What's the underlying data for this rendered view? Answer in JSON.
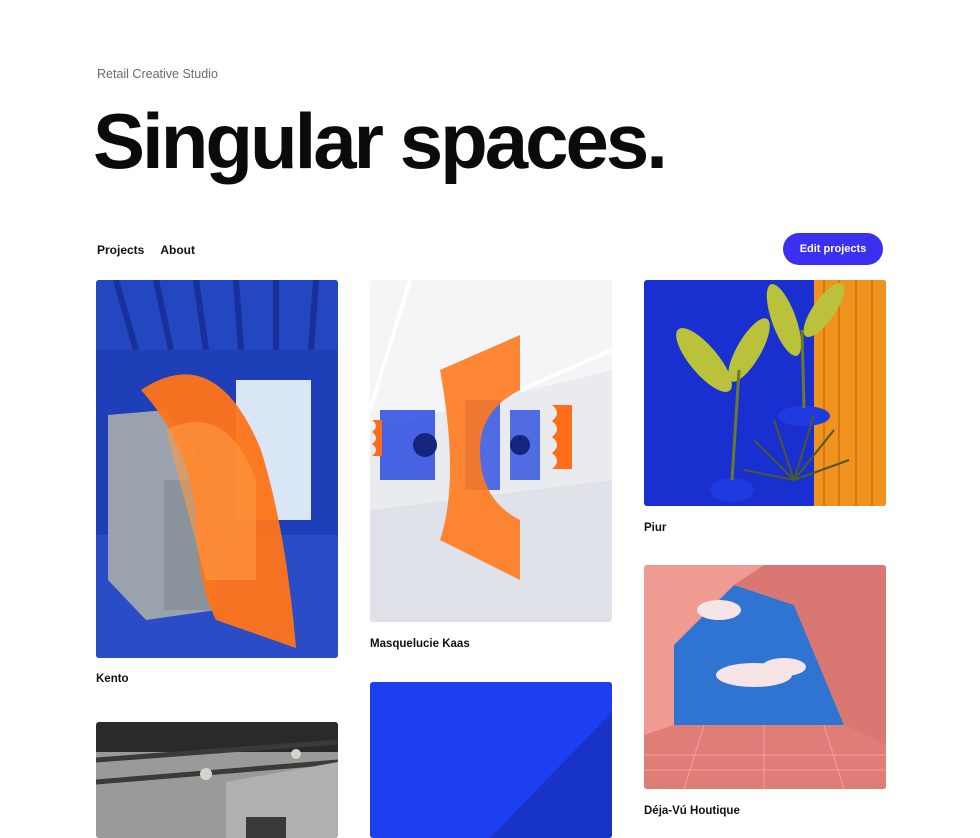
{
  "studio": {
    "eyebrow": "Retail Creative Studio",
    "headline": "Singular spaces."
  },
  "nav": {
    "items": [
      {
        "label": "Projects"
      },
      {
        "label": "About"
      }
    ]
  },
  "actions": {
    "edit_label": "Edit projects"
  },
  "projects": [
    {
      "title": "Kento"
    },
    {
      "title": "Masquelucie Kaas"
    },
    {
      "title": "Piur"
    },
    {
      "title": "Déja-Vú Houtique"
    },
    {
      "title": ""
    },
    {
      "title": ""
    }
  ],
  "colors": {
    "accent": "#3b2ff0",
    "klein_blue": "#1f3fd6",
    "orange": "#ff7a1a",
    "pink": "#e88a86"
  }
}
